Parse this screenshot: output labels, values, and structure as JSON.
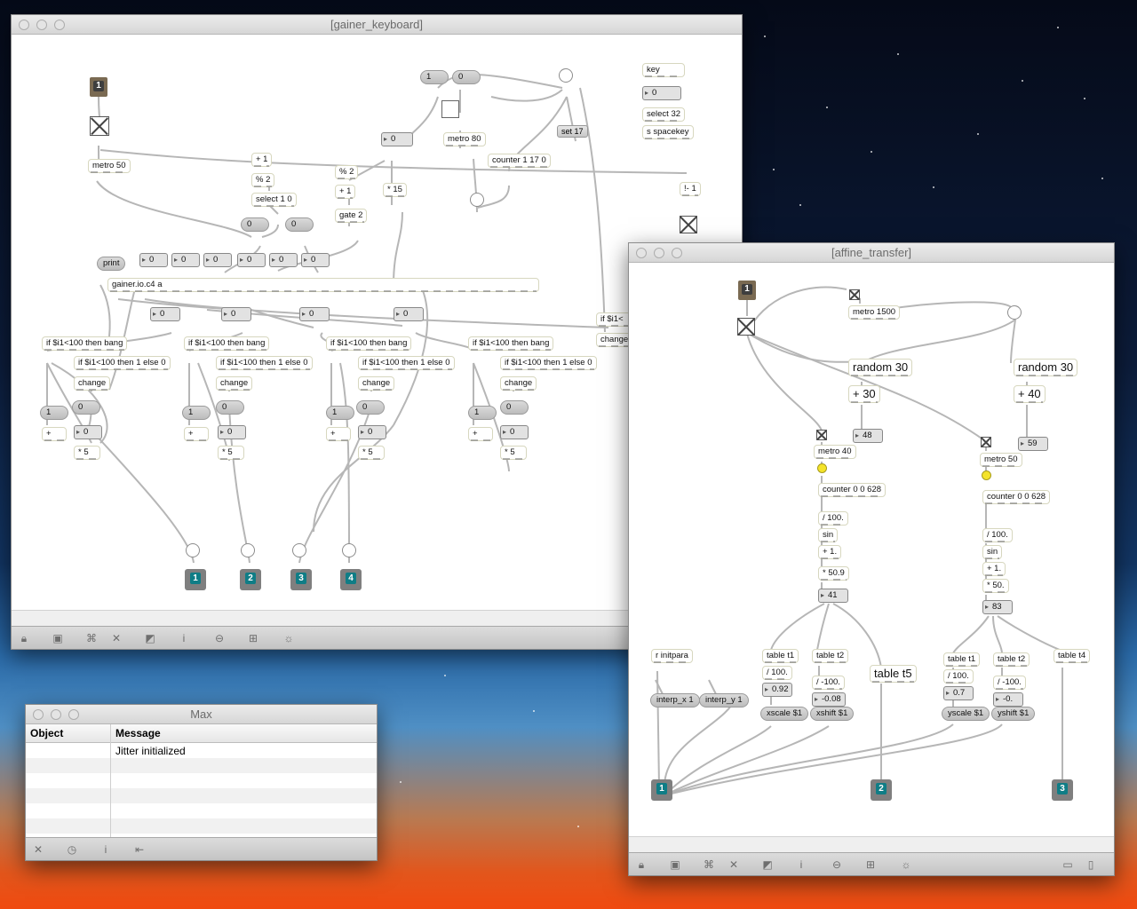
{
  "windows": {
    "gainer": {
      "title": "[gainer_keyboard]",
      "objects": {
        "metro50": "metro 50",
        "plus1": "+ 1",
        "mod2a": "% 2",
        "select10": "select 1 0",
        "mod2b": "% 2",
        "plus1b": "+ 1",
        "gate2": "gate 2",
        "mul15": "* 15",
        "metro80": "metro 80",
        "counter": "counter 1 17 0",
        "set17": "set 17",
        "key": "key",
        "select32": "select 32",
        "spacekey": "s spacekey",
        "notminus1": "!- 1",
        "gainer_io": "gainer.io.c4 a",
        "if_bang": "if $i1<100 then bang",
        "if_else": "if $i1<100 then 1 else 0",
        "change": "change",
        "plus": "+",
        "mul5": "* 5",
        "if_partial": "if $i1<",
        "change_partial": "change"
      },
      "numbers": {
        "zero": "0",
        "one": "1"
      },
      "messages": {
        "print": "print",
        "one": "1",
        "zero": "0",
        "set17": "set 17"
      },
      "inlet": "1",
      "outlets": [
        "1",
        "2",
        "3",
        "4"
      ]
    },
    "max": {
      "title": "Max",
      "columns": {
        "object": "Object",
        "message": "Message"
      },
      "rows": [
        {
          "object": "",
          "message": "Jitter initialized"
        }
      ]
    },
    "affine": {
      "title": "[affine_transfer]",
      "objects": {
        "metro1500": "metro 1500",
        "random30a": "random 30",
        "random30b": "random 30",
        "plus30": "+ 30",
        "plus40": "+ 40",
        "metro40": "metro 40",
        "metro50": "metro 50",
        "counter0": "counter 0 0 628",
        "div100": "/ 100.",
        "sin": "sin",
        "plus1": "+ 1.",
        "mul509": "* 50.9",
        "mul50": "* 50.",
        "tablet1": "table t1",
        "tablet2": "table t2",
        "tablet5": "table t5",
        "tablet4": "table t4",
        "divm100": "/ -100.",
        "rinit": "r initpara",
        "interpx": "interp_x 1",
        "interpy": "interp_y 1",
        "xscale": "xscale $1",
        "xshift": "xshift $1",
        "yscale": "yscale $1",
        "yshift": "yshift $1"
      },
      "numbers": {
        "n48": "48",
        "n59": "59",
        "n41": "41",
        "n83": "83",
        "n092": "0.92",
        "nm008": "-0.08",
        "n07": "0.7",
        "nm0": "-0."
      },
      "inlet": "1",
      "outlets": [
        "1",
        "2",
        "3"
      ]
    }
  },
  "toolbar_icons": [
    "lock-icon",
    "presentation-icon",
    "patchcord-icon",
    "delete-icon",
    "inspector-icon",
    "info-icon",
    "slider-icon",
    "grid-icon",
    "sun-icon"
  ]
}
